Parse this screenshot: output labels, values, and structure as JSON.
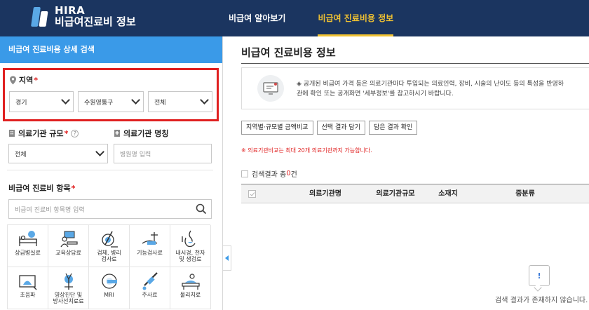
{
  "header": {
    "logo_en": "HIRA",
    "logo_ko": "비급여진료비 정보",
    "nav": [
      {
        "label": "비급여 알아보기",
        "active": false
      },
      {
        "label": "비급여 진료비용 정보",
        "active": true
      }
    ]
  },
  "left": {
    "title": "비급여 진료비용 상세 검색",
    "region": {
      "label": "지역",
      "required_mark": "*",
      "selects": [
        "경기",
        "수원영통구",
        "전체"
      ]
    },
    "scale": {
      "label": "의료기관 규모",
      "required_mark": "*",
      "value": "전체"
    },
    "institution_name": {
      "label": "의료기관 명칭",
      "placeholder": "병원명 입력"
    },
    "items": {
      "label": "비급여 진료비 항목",
      "required_mark": "*",
      "search_placeholder": "비급여 진료비 항목명 입력",
      "grid": [
        {
          "label": "상급병실료",
          "icon": "hospital-bed-icon"
        },
        {
          "label": "교육상담료",
          "icon": "counseling-icon"
        },
        {
          "label": "검체, 병리\n검사료",
          "icon": "lab-test-icon"
        },
        {
          "label": "기능검사료",
          "icon": "function-test-icon"
        },
        {
          "label": "내시경, 천자\n및 생검료",
          "icon": "endoscope-icon"
        },
        {
          "label": "초음파",
          "icon": "ultrasound-icon"
        },
        {
          "label": "영상진단 및\n방사선치료료",
          "icon": "radiology-icon"
        },
        {
          "label": "MRI",
          "icon": "mri-icon"
        },
        {
          "label": "주사료",
          "icon": "syringe-icon"
        },
        {
          "label": "물리치료",
          "icon": "physical-therapy-icon"
        }
      ]
    }
  },
  "right": {
    "title": "비급여 진료비용 정보",
    "notice_line1": "◈ 공개된 비급여 가격 등은 의료기관마다 투입되는 의료인력, 장비, 시술의 난이도 등의 특성을 반영하",
    "notice_line2": "관에 확인 또는 공개화면 '세부정보'를 참고하시기 바랍니다.",
    "buttons": [
      "지역별·규모별 금액비교",
      "선택 결과 담기",
      "담은 결과 확인"
    ],
    "warning": "※ 의료기관비교는 최대 20개 의료기관까지 가능합니다.",
    "count_prefix": "검색결과 총 ",
    "count_value": "0",
    "count_suffix": "건",
    "columns": [
      "의료기관명",
      "의료기관규모",
      "소재지",
      "중분류"
    ],
    "empty_mark": "!",
    "empty_text": "검색 결과가 존재하지 않습니다."
  },
  "colors": {
    "header_bg": "#1b3560",
    "nav_active": "#f1c232",
    "accent_blue": "#3a9ae8",
    "highlight_border": "#e02020"
  }
}
